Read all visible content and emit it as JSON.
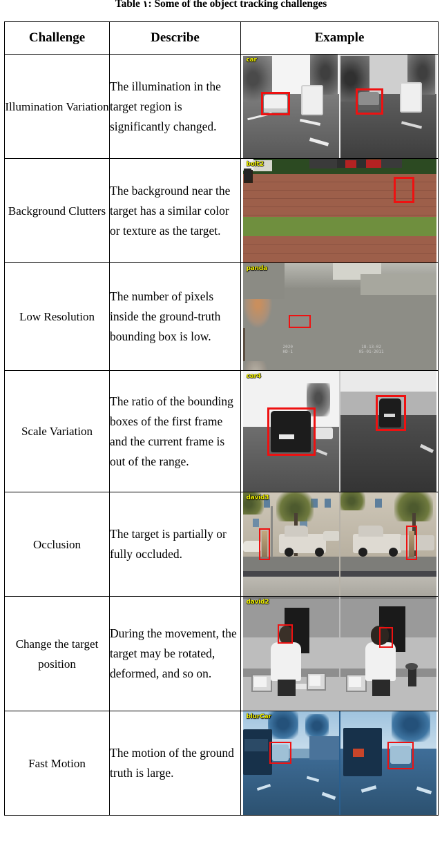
{
  "caption": {
    "prefix": "Table ",
    "number": "۱",
    "suffix": ": Some of the object tracking challenges",
    "full_text": "Table ۱: Some of the object tracking challenges"
  },
  "table": {
    "columns": [
      "Challenge",
      "Describe",
      "Example"
    ],
    "rows": [
      {
        "challenge": "Illumination Variation",
        "describe": "The illumination in the target region is significantly changed.",
        "example": {
          "sequence_tag": "car",
          "scene": "grayscale highway, white car and utility truck, two frames with different exposure",
          "panes": 2,
          "bbox_color": "#ee1111",
          "tag_color": "#f2f200"
        }
      },
      {
        "challenge": "Background Clutters",
        "describe": "The background near the target has a similar color or texture as the target.",
        "example": {
          "sequence_tag": "bolt2",
          "scene": "athletics track, sprinters at start, cluttered crowd background",
          "panes": 1,
          "bbox_color": "#ee1111",
          "tag_color": "#f2f200"
        }
      },
      {
        "challenge": "Low Resolution",
        "describe": "The number of pixels inside the ground-truth bounding box is low.",
        "example": {
          "sequence_tag": "panda",
          "scene": "low-res surveillance view of a panda enclosure courtyard with bare trees",
          "panes": 1,
          "bbox_color": "#ee1111",
          "tag_color": "#f2f200"
        }
      },
      {
        "challenge": "Scale Variation",
        "describe": "The ratio of the bounding boxes of the first frame and the current frame is out of the range.",
        "example": {
          "sequence_tag": "car4",
          "scene": "dark SUV on road under a steel overpass, near frame and far frame",
          "panes": 2,
          "bbox_color": "#ee1111",
          "tag_color": "#f2f200"
        }
      },
      {
        "challenge": "Occlusion",
        "describe": "The target is partially or fully occluded.",
        "example": {
          "sequence_tag": "david3",
          "scene": "city street with parked pickup truck, pedestrian occluded by pole and tree",
          "panes": 2,
          "bbox_color": "#ee1111",
          "tag_color": "#f2f200"
        }
      },
      {
        "challenge": "Change the target position",
        "describe": "During the movement, the target may be rotated, deformed, and so on.",
        "example": {
          "sequence_tag": "david2",
          "scene": "grayscale office, man in white t-shirt turning his head, monitors on desk",
          "panes": 2,
          "bbox_color": "#ee1111",
          "tag_color": "#f2f200"
        }
      },
      {
        "challenge": "Fast Motion",
        "describe": "The motion of the ground truth is large.",
        "example": {
          "sequence_tag": "blurCar",
          "scene": "blue-tinted motion-blurred road scene with lorry and car, two frames",
          "panes": 2,
          "bbox_color": "#ee1111",
          "tag_color": "#f2f200"
        }
      }
    ]
  }
}
